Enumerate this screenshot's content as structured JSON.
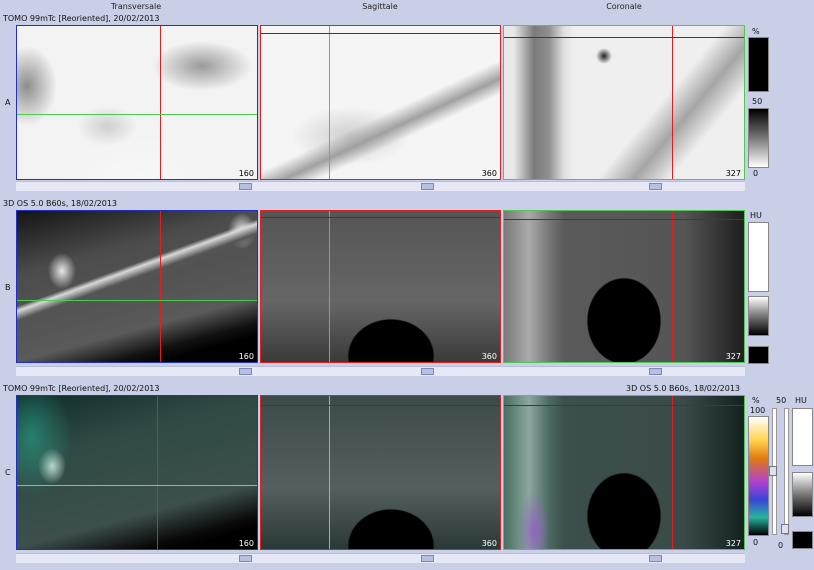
{
  "columns": {
    "transversale": "Transversale",
    "sagittale": "Sagittale",
    "coronale": "Coronale"
  },
  "rows": {
    "A": {
      "letter": "A",
      "title": "TOMO 99mTc [Reoriented], 20/02/2013"
    },
    "B": {
      "letter": "B",
      "title": "3D  OS  5.0  B60s, 18/02/2013"
    },
    "C": {
      "letter": "C",
      "title": "TOMO 99mTc [Reoriented], 20/02/2013",
      "title_right": "3D  OS  5.0  B60s, 18/02/2013"
    }
  },
  "slices": {
    "transversale": "160",
    "sagittale": "360",
    "coronale": "327"
  },
  "scale_a": {
    "unit": "%",
    "top": "",
    "mid": "50",
    "bottom": "0"
  },
  "scale_b": {
    "unit": "HU"
  },
  "scale_c": {
    "unit": "%",
    "top": "100",
    "bottom": "0",
    "mid2": "50",
    "unit2": "HU",
    "bottom2": "0"
  },
  "colors": {
    "red": "#e02020",
    "green": "#4fc84f",
    "blue": "#2030c0",
    "panel_bg": "#c9cfe6"
  }
}
